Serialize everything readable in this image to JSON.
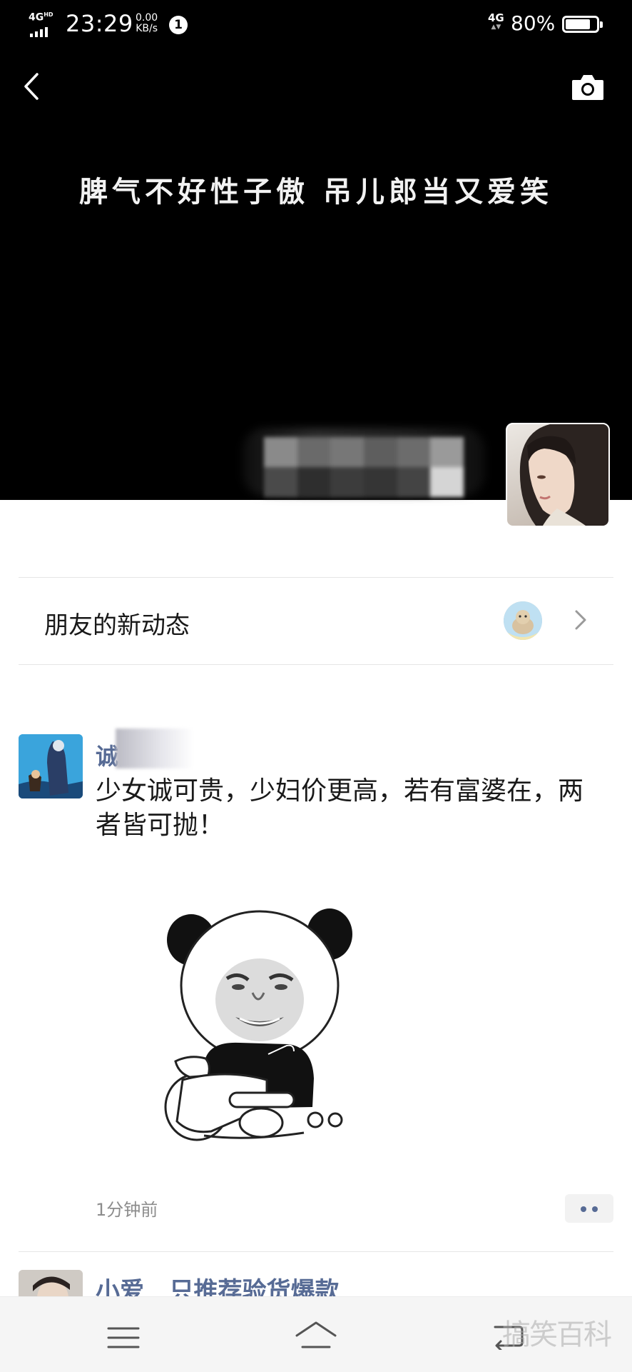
{
  "status_bar": {
    "network_tag": "4G",
    "network_tag_sup": "HD",
    "time": "23:29",
    "speed_value": "0.00",
    "speed_unit": "KB/s",
    "notification_count": "1",
    "signal_label": "4G",
    "battery_percent": "80%",
    "battery_level": 0.8
  },
  "cover": {
    "background_color": "#000000",
    "signature": "脾气不好性子傲 吊儿郎当又爱笑"
  },
  "friends_activity": {
    "label": "朋友的新动态"
  },
  "post": {
    "author": "诚",
    "text": "少女诚可贵，少妇价更高，若有富婆在，两者皆可抛！",
    "time": "1分钟前"
  },
  "next_post": {
    "author": "小爱",
    "text": "只推荐验货爆款"
  },
  "watermark": "搞笑百科",
  "colors": {
    "link": "#576b95",
    "text": "#191919",
    "muted": "#8c8c8c",
    "divider": "#e6e6e6"
  },
  "icons": [
    "back-icon",
    "camera-icon",
    "chevron-right-icon",
    "more-dots-icon",
    "menu-icon",
    "home-icon",
    "back-nav-icon"
  ]
}
